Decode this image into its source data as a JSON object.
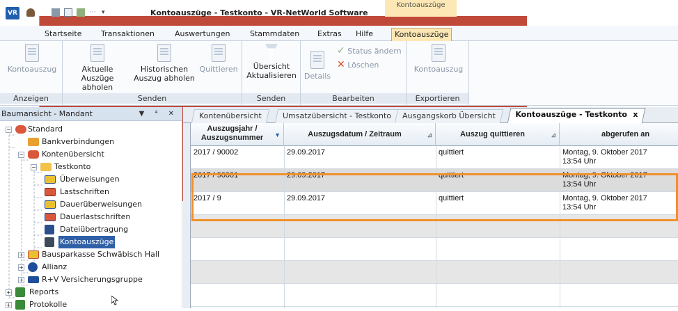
{
  "title_bar": {
    "window_title": "Kontoauszüge - Testkonto - VR-NetWorld Software",
    "context_tab_header": "Kontoauszüge"
  },
  "menu": {
    "tabs": [
      "Startseite",
      "Transaktionen",
      "Auswertungen",
      "Stammdaten",
      "Extras",
      "Hilfe",
      "Kontoauszüge"
    ],
    "active": "Kontoauszüge"
  },
  "ribbon": {
    "groups": {
      "anzeigen": {
        "label": "Anzeigen",
        "kontoauszug": "Kontoauszug"
      },
      "senden": {
        "label": "Senden",
        "aktuelle_line1": "Aktuelle Auszüge",
        "aktuelle_line2": "abholen",
        "historische_line1": "Historischen",
        "historische_line2": "Auszug abholen",
        "quittieren": "Quittieren"
      },
      "senden2": {
        "label": "Senden",
        "uebersicht_line1": "Übersicht",
        "uebersicht_line2": "Aktualisieren"
      },
      "bearbeiten": {
        "label": "Bearbeiten",
        "details": "Details",
        "status_aendern": "Status ändern",
        "loeschen": "Löschen"
      },
      "exportieren": {
        "label": "Exportieren",
        "kontoauszug": "Kontoauszug"
      }
    }
  },
  "tree": {
    "header": "Baumansicht - Mandant",
    "header_buttons": "▼ ⁴ ✕",
    "items": [
      {
        "label": "Standard"
      },
      {
        "label": "Bankverbindungen"
      },
      {
        "label": "Kontenübersicht"
      },
      {
        "label": "Testkonto"
      },
      {
        "label": "Überweisungen"
      },
      {
        "label": "Lastschriften"
      },
      {
        "label": "Daueruberweisungen_display",
        "display": "Dauerüberweisungen"
      },
      {
        "label": "Dauerlastschriften"
      },
      {
        "label": "Dateiübertragung"
      },
      {
        "label": "Kontoauszüge"
      },
      {
        "label": "Bausparkasse Schwäbisch Hall"
      },
      {
        "label": "Allianz"
      },
      {
        "label": "R+V Versicherungsgruppe"
      },
      {
        "label": "Reports"
      },
      {
        "label": "Protokolle"
      }
    ]
  },
  "doc_tabs": [
    {
      "label": "Kontenübersicht"
    },
    {
      "label": "Umsatzübersicht - Testkonto"
    },
    {
      "label": "Ausgangskorb Übersicht"
    },
    {
      "label": "Kontoauszüge - Testkonto",
      "close": "x"
    }
  ],
  "table": {
    "columns": [
      {
        "line1": "Auszugsjahr /",
        "line2": "Auszugsnummer"
      },
      {
        "line1": "Auszugsdatum / Zeitraum"
      },
      {
        "line1": "Auszug quittieren"
      },
      {
        "line1": "abgerufen an"
      }
    ],
    "rows": [
      {
        "nummer": "2017 / 90002",
        "datum": "29.09.2017",
        "status": "quittiert",
        "abgerufen_line1": "Montag, 9. Oktober 2017",
        "abgerufen_line2": "13:54 Uhr"
      },
      {
        "nummer": "2017 / 90001",
        "datum": "29.09.2017",
        "status": "quittiert",
        "abgerufen_line1": "Montag, 9. Oktober 2017",
        "abgerufen_line2": "13:54 Uhr"
      },
      {
        "nummer": "2017 / 9",
        "datum": "29.09.2017",
        "status": "quittiert",
        "abgerufen_line1": "Montag, 9. Oktober 2017",
        "abgerufen_line2": "13:54 Uhr"
      }
    ]
  },
  "colors": {
    "highlight": "#f0902a",
    "context_tab": "#fde8b5",
    "selection": "#2f5fa6"
  }
}
